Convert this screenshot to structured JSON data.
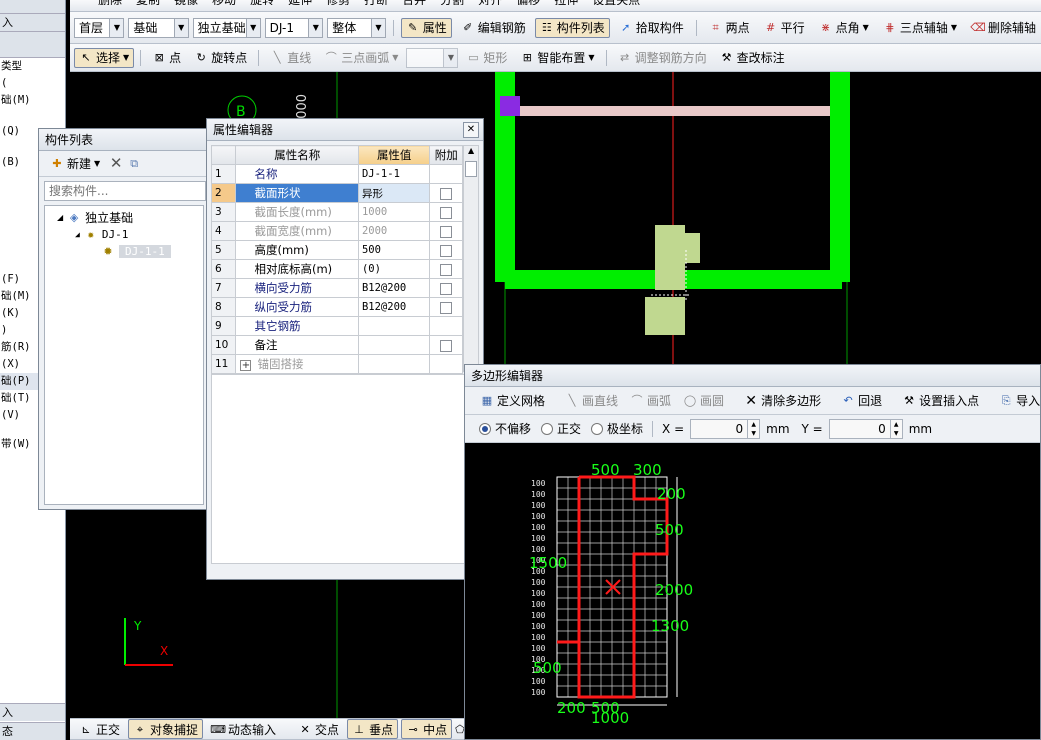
{
  "menu_top": {
    "items": [
      "删除",
      "复制",
      "镜像",
      "移动",
      "旋转",
      "延伸",
      "修剪",
      "打断",
      "合并",
      "分割",
      "对齐",
      "偏移",
      "拉伸",
      "设置夹点"
    ]
  },
  "toolbar2": {
    "floor": "首层",
    "category": "基础",
    "type": "独立基础",
    "component": "DJ-1",
    "part": "整体",
    "attr_btn": "属性",
    "edit_rebar": "编辑钢筋",
    "comp_list": "构件列表",
    "pick": "拾取构件",
    "two_pt": "两点",
    "parallel": "平行",
    "pt_angle": "点角",
    "three_pt_aux": "三点辅轴",
    "del_aux": "删除辅轴"
  },
  "toolbar3": {
    "select": "选择",
    "point": "点",
    "rot_point": "旋转点",
    "line": "直线",
    "arc3": "三点画弧",
    "rect": "矩形",
    "smart": "智能布置",
    "adjust_dir": "调整钢筋方向",
    "check_mark": "查改标注"
  },
  "left_panel": {
    "items": [
      "类型",
      "(",
      "础(M)",
      "(Q)",
      "(B)",
      "(F)",
      "础(M)",
      "(K)",
      ")",
      "筋(R)",
      "(X)",
      "础(P)",
      "础(T)",
      "(V)",
      "带(W)"
    ],
    "bottom1": "入",
    "bottom2": "态"
  },
  "canvas": {
    "axis_label": "B",
    "dim_text": "0000",
    "y_axis": "Y",
    "x_axis": "X"
  },
  "comp_list": {
    "title": "构件列表",
    "new_btn": "新建",
    "search_placeholder": "搜索构件...",
    "tree": {
      "root": "独立基础",
      "child": "DJ-1",
      "leaf": "DJ-1-1"
    }
  },
  "prop_editor": {
    "title": "属性编辑器",
    "headers": [
      "属性名称",
      "属性值",
      "附加"
    ],
    "rows": [
      {
        "n": "1",
        "name": "名称",
        "value": "DJ-1-1",
        "chk": false,
        "style": "blue"
      },
      {
        "n": "2",
        "name": "截面形状",
        "value": "异形",
        "chk": true,
        "style": "blue"
      },
      {
        "n": "3",
        "name": "截面长度(mm)",
        "value": "1000",
        "chk": true,
        "style": "gray"
      },
      {
        "n": "4",
        "name": "截面宽度(mm)",
        "value": "2000",
        "chk": true,
        "style": "gray"
      },
      {
        "n": "5",
        "name": "高度(mm)",
        "value": "500",
        "chk": true,
        "style": ""
      },
      {
        "n": "6",
        "name": "相对底标高(m)",
        "value": "(0)",
        "chk": true,
        "style": ""
      },
      {
        "n": "7",
        "name": "横向受力筋",
        "value": "B12@200",
        "chk": true,
        "style": "blue"
      },
      {
        "n": "8",
        "name": "纵向受力筋",
        "value": "B12@200",
        "chk": true,
        "style": "blue"
      },
      {
        "n": "9",
        "name": "其它钢筋",
        "value": "",
        "chk": false,
        "style": "blue"
      },
      {
        "n": "10",
        "name": "备注",
        "value": "",
        "chk": true,
        "style": ""
      },
      {
        "n": "11",
        "name": "锚固搭接",
        "value": "",
        "chk": false,
        "style": "gray"
      }
    ]
  },
  "poly_editor": {
    "title": "多边形编辑器",
    "tools": [
      "定义网格",
      "画直线",
      "画弧",
      "画圆",
      "清除多边形",
      "回退",
      "设置插入点",
      "导入"
    ],
    "mode_none": "不偏移",
    "mode_ortho": "正交",
    "mode_polar": "极坐标",
    "x_label": "X =",
    "x_val": "0",
    "x_unit": "mm",
    "y_label": "Y =",
    "y_val": "0",
    "y_unit": "mm",
    "dims": [
      "500",
      "300",
      "200",
      "500",
      "1500",
      "2000",
      "1300",
      "500",
      "200",
      "500",
      "1000"
    ],
    "tick": "100"
  },
  "status_bar": {
    "items": [
      "正交",
      "对象捕捉",
      "动态输入",
      "交点",
      "垂点",
      "中点"
    ]
  }
}
